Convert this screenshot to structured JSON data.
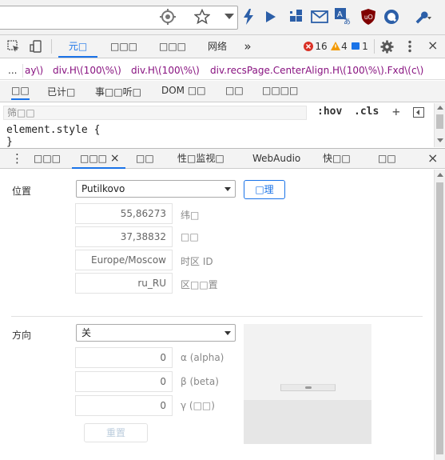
{
  "browser": {
    "icons": [
      "target-icon",
      "star-icon",
      "dropdown-icon",
      "lightning-icon",
      "play-icon",
      "extensions-icon",
      "mail-icon",
      "translate-icon",
      "ublock-icon",
      "compass-icon",
      "wrench-icon"
    ]
  },
  "devtools": {
    "tabs": [
      "元□",
      "□□□",
      "□□□",
      "网络"
    ],
    "more": "»",
    "errors": "16",
    "warnings": "4",
    "messages": "1"
  },
  "breadcrumb": {
    "ellipsis": "...",
    "items": [
      "ay\\)",
      "div.H\\(100\\%\\)",
      "div.H\\(100\\%\\)",
      "div.recsPage.CenterAlign.H\\(100\\%\\).Fxd\\(c\\)"
    ]
  },
  "subtabs": [
    "□□",
    "已计□",
    "事□□听□",
    "DOM □□",
    "□□",
    "□□□□"
  ],
  "styles": {
    "filter_placeholder": "筛□□",
    "hov": ":hov",
    "cls": ".cls",
    "plus": "+",
    "rule": "element.style {",
    "close_brace": "}"
  },
  "drawer": {
    "menu": "⋮",
    "tabs": [
      "□□□",
      "□□□",
      "□□",
      "性□监视□",
      "WebAudio",
      "快□□",
      "□□"
    ],
    "close_tab": "×",
    "close": "×"
  },
  "sensors": {
    "location_label": "位置",
    "location_value": "Putilkovo",
    "manage_button": "□理",
    "latitude": "55,86273",
    "latitude_label": "纬□",
    "longitude": "37,38832",
    "longitude_label": "□□",
    "timezone": "Europe/Moscow",
    "timezone_label": "时区 ID",
    "locale": "ru_RU",
    "locale_label": "区□□置",
    "orientation_label": "方向",
    "orientation_value": "关",
    "alpha": "0",
    "alpha_label": "α (alpha)",
    "beta": "0",
    "beta_label": "β (beta)",
    "gamma": "0",
    "gamma_label": "γ (□□)",
    "reset_button": "重置"
  },
  "colors": {
    "accent": "#1a73e8",
    "error": "#d93025",
    "warning": "#f29900",
    "info": "#1a73e8"
  }
}
